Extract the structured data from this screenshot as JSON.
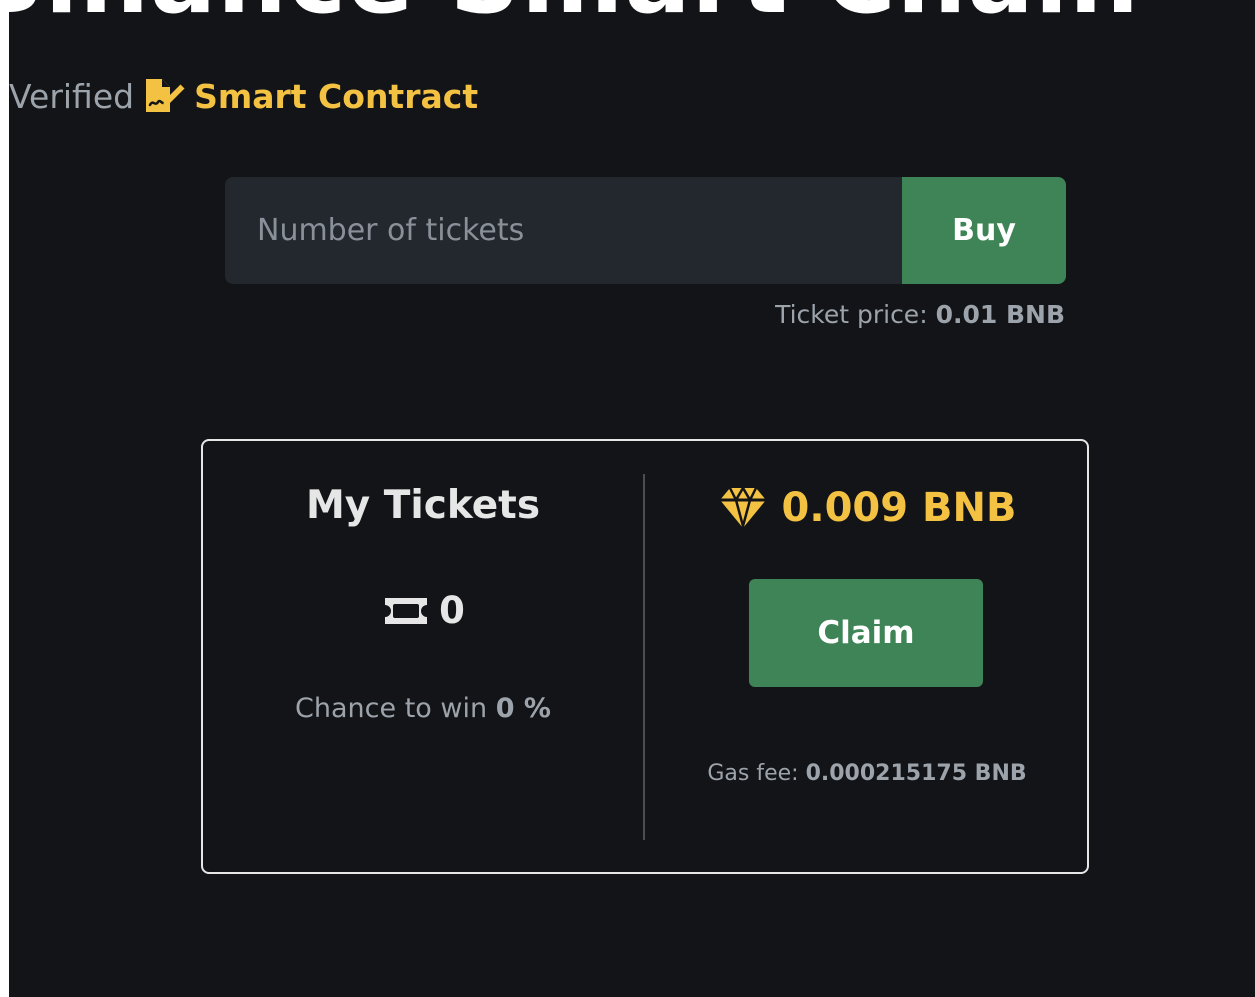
{
  "hero": {
    "title": "Binance Smart Chain"
  },
  "verified": {
    "prefix": "Verified",
    "link_label": "Smart Contract"
  },
  "buy": {
    "input_placeholder": "Number of tickets",
    "input_value": "",
    "button_label": "Buy",
    "price_label": "Ticket price:",
    "price_value": "0.01 BNB"
  },
  "my_tickets": {
    "title": "My Tickets",
    "count": "0",
    "chance_label": "Chance to win",
    "chance_value": "0 %"
  },
  "prize": {
    "amount": "0.009 BNB",
    "claim_label": "Claim",
    "gas_label": "Gas fee:",
    "gas_value": "0.000215175 BNB"
  },
  "icons": {
    "contract": "file-signature-icon",
    "ticket": "ticket-icon",
    "prize": "gem-icon"
  },
  "colors": {
    "background": "#131418",
    "accent_gold": "#f4c242",
    "button_green": "#3f8457",
    "input_bg": "#23272e",
    "muted_text": "#9ca3ab",
    "card_border": "#e6e6e6"
  }
}
